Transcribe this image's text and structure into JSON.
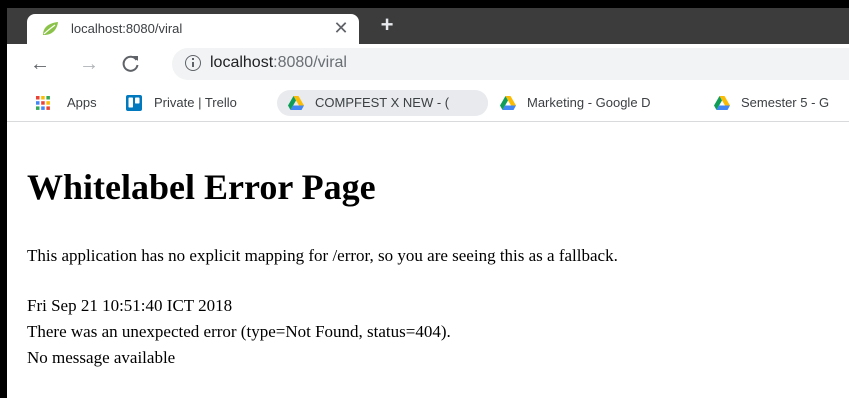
{
  "browser": {
    "tab": {
      "title": "localhost:8080/viral",
      "favicon": "spring-leaf-icon",
      "close_glyph": "✕"
    },
    "new_tab_glyph": "+",
    "nav": {
      "back_glyph": "←",
      "forward_glyph": "→",
      "reload_glyph": "C"
    },
    "address_bar": {
      "host": "localhost",
      "rest": ":8080/viral",
      "icon": "info-icon"
    },
    "bookmarks": [
      {
        "label": "Apps",
        "icon": "apps-grid-icon"
      },
      {
        "label": "Private | Trello",
        "icon": "trello-icon"
      },
      {
        "label": "COMPFEST X NEW - (",
        "icon": "google-drive-icon"
      },
      {
        "label": "Marketing - Google D",
        "icon": "google-drive-icon"
      },
      {
        "label": "Semester 5 - G",
        "icon": "google-drive-icon"
      }
    ]
  },
  "page": {
    "title": "Whitelabel Error Page",
    "description": "This application has no explicit mapping for /error, so you are seeing this as a fallback.",
    "timestamp": "Fri Sep 21 10:51:40 ICT 2018",
    "error_line": "There was an unexpected error (type=Not Found, status=404).",
    "message": "No message available"
  },
  "colors": {
    "titlebar": "#3c3c3c",
    "omnibox": "#f1f3f4",
    "trello": "#0079bf"
  }
}
